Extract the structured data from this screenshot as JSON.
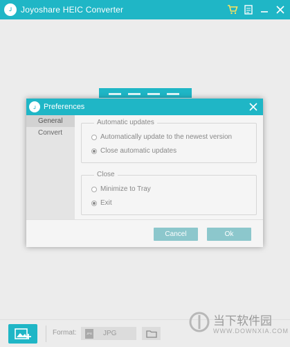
{
  "window": {
    "title": "Joyoshare HEIC Converter",
    "logo_text": "Ｊ"
  },
  "titlebar_icons": [
    "cart-icon",
    "register-icon",
    "minimize-icon",
    "close-icon"
  ],
  "dialog": {
    "title": "Preferences",
    "sidebar": [
      {
        "label": "General",
        "active": true
      },
      {
        "label": "Convert",
        "active": false
      }
    ],
    "updates": {
      "legend": "Automatic updates",
      "options": [
        {
          "label": "Automatically update to the newest version",
          "checked": false
        },
        {
          "label": "Close automatic updates",
          "checked": true
        }
      ]
    },
    "close": {
      "legend": "Close",
      "options": [
        {
          "label": "Minimize to Tray",
          "checked": false
        },
        {
          "label": "Exit",
          "checked": true
        }
      ]
    },
    "cancel_label": "Cancel",
    "ok_label": "Ok"
  },
  "bottom": {
    "format_label": "Format:",
    "format_value": "JPG",
    "format_icon_text": "JPG"
  },
  "watermark": {
    "text": "当下软件园",
    "sub": "WWW.DOWNXIA.COM"
  },
  "colors": {
    "accent": "#1fb6c6",
    "button_disabled": "#8cc7cc",
    "background": "#ececec"
  }
}
